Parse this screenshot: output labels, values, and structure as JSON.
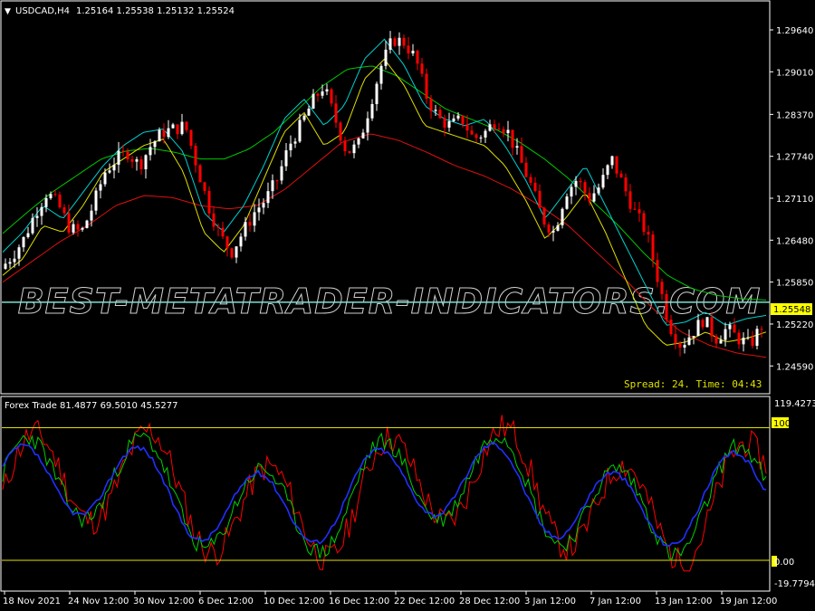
{
  "colors": {
    "background": "#000000",
    "frame": "#ffffff",
    "bull_candle": "#ffffff",
    "bear_candle": "#ff0000",
    "ma_green": "#00c800",
    "ma_cyan": "#00d0d0",
    "ma_yellow": "#e0e000",
    "ma_red": "#dd1010",
    "price_line": "#7fe0d0",
    "price_tag_bg": "#ffff00",
    "level_line": "#e0e000",
    "osc_red": "#ff0000",
    "osc_green": "#00d000",
    "osc_blue": "#2030ff",
    "spread_text": "#e0e000",
    "watermark": "#d0d0d0"
  },
  "main_chart": {
    "symbol_label": "USDCAD,H4",
    "ohlc": "1.25164 1.25538 1.25132 1.25524",
    "price_ticks": [
      "1.29640",
      "1.29010",
      "1.28370",
      "1.27740",
      "1.27110",
      "1.26480",
      "1.25850",
      "1.25220",
      "1.24590"
    ],
    "current_price": "1.25548",
    "spread_info": "Spread: 24. Time: 04:43",
    "watermark": "BEST-METATRADER-INDICATORS.COM"
  },
  "sub_chart": {
    "indicator_label": "Forex Trade 81.4877 69.5010 45.5277",
    "scale_max": "119.4273",
    "scale_min": "-19.7794",
    "level_100": "100",
    "level_0": "0.00"
  },
  "time_axis": [
    "18 Nov 2021",
    "24 Nov 12:00",
    "30 Nov 12:00",
    "6 Dec 12:00",
    "10 Dec 12:00",
    "16 Dec 12:00",
    "22 Dec 12:00",
    "28 Dec 12:00",
    "3 Jan 12:00",
    "7 Jan 12:00",
    "13 Jan 12:00",
    "19 Jan 12:00"
  ],
  "chart_data": {
    "type": "candlestick",
    "y_range": [
      1.2424,
      1.2998
    ],
    "osc_range": [
      -19.7794,
      119.4273
    ],
    "price_path": [
      1.2605,
      1.2625,
      1.265,
      1.269,
      1.272,
      1.27,
      1.2665,
      1.266,
      1.27,
      1.275,
      1.277,
      1.278,
      1.276,
      1.279,
      1.281,
      1.2815,
      1.282,
      1.276,
      1.27,
      1.2655,
      1.263,
      1.266,
      1.269,
      1.271,
      1.274,
      1.279,
      1.282,
      1.2855,
      1.288,
      1.283,
      1.278,
      1.279,
      1.285,
      1.291,
      1.295,
      1.2945,
      1.292,
      1.286,
      1.283,
      1.282,
      1.283,
      1.28,
      1.281,
      1.283,
      1.281,
      1.277,
      1.273,
      1.268,
      1.266,
      1.272,
      1.274,
      1.271,
      1.273,
      1.277,
      1.273,
      1.269,
      1.266,
      1.259,
      1.252,
      1.249,
      1.251,
      1.253,
      1.25,
      1.2515,
      1.25,
      1.249,
      1.252
    ],
    "ma_green": [
      1.2658,
      1.269,
      1.272,
      1.2745,
      1.277,
      1.2782,
      1.2786,
      1.278,
      1.277,
      1.277,
      1.2785,
      1.281,
      1.2845,
      1.288,
      1.2905,
      1.291,
      1.2895,
      1.287,
      1.2845,
      1.283,
      1.2815,
      1.2795,
      1.277,
      1.274,
      1.2705,
      1.267,
      1.263,
      1.2595,
      1.2575,
      1.2565,
      1.256,
      1.2558
    ],
    "ma_cyan": [
      1.263,
      1.266,
      1.27,
      1.268,
      1.272,
      1.276,
      1.279,
      1.281,
      1.2815,
      1.278,
      1.269,
      1.266,
      1.27,
      1.276,
      1.283,
      1.286,
      1.282,
      1.285,
      1.292,
      1.295,
      1.291,
      1.285,
      1.283,
      1.282,
      1.283,
      1.279,
      1.274,
      1.268,
      1.272,
      1.276,
      1.27,
      1.264,
      1.258,
      1.252,
      1.2525,
      1.254,
      1.252,
      1.253,
      1.2535
    ],
    "ma_yellow": [
      1.2595,
      1.262,
      1.267,
      1.266,
      1.27,
      1.275,
      1.277,
      1.279,
      1.28,
      1.275,
      1.266,
      1.263,
      1.267,
      1.274,
      1.281,
      1.284,
      1.279,
      1.281,
      1.289,
      1.292,
      1.288,
      1.282,
      1.281,
      1.28,
      1.279,
      1.276,
      1.271,
      1.265,
      1.268,
      1.272,
      1.266,
      1.259,
      1.252,
      1.249,
      1.2495,
      1.251,
      1.2495,
      1.25,
      1.251
    ],
    "ma_red": [
      1.2585,
      1.2615,
      1.2645,
      1.267,
      1.27,
      1.2715,
      1.2712,
      1.27,
      1.2695,
      1.27,
      1.2725,
      1.276,
      1.2795,
      1.2808,
      1.2798,
      1.278,
      1.276,
      1.2745,
      1.2725,
      1.27,
      1.267,
      1.263,
      1.259,
      1.2545,
      1.251,
      1.249,
      1.2478,
      1.2472
    ]
  }
}
